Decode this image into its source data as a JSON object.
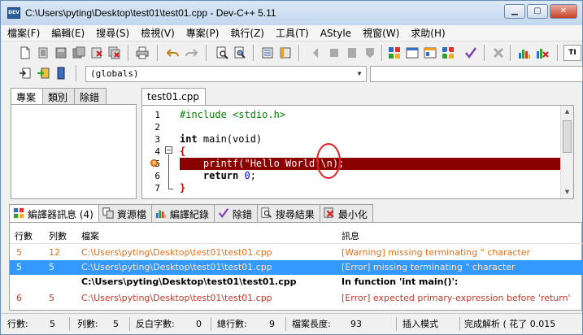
{
  "window": {
    "title": "C:\\Users\\pyting\\Desktop\\test01\\test01.cpp - Dev-C++ 5.11",
    "minimize": "▁",
    "maximize": "▢",
    "close": "✕"
  },
  "menu": [
    "檔案(F)",
    "編輯(E)",
    "搜尋(S)",
    "檢視(V)",
    "專案(P)",
    "執行(Z)",
    "工具(T)",
    "AStyle",
    "視窗(W)",
    "求助(H)"
  ],
  "toolbar": {
    "overflow_label": "TI",
    "scope_combo": "(globals)",
    "function_combo": ""
  },
  "left_panel": {
    "tabs": [
      "專案",
      "類別",
      "除錯"
    ]
  },
  "editor": {
    "tab": "test01.cpp",
    "line_numbers": [
      "1",
      "2",
      "3",
      "4",
      "5",
      "6",
      "7"
    ],
    "lines": [
      {
        "type": "pp",
        "text": "#include <stdio.h>"
      },
      {
        "type": "blank",
        "text": ""
      },
      {
        "type": "code",
        "kw": "int",
        "rest": " main(void)"
      },
      {
        "type": "brace",
        "text": "{"
      },
      {
        "type": "err",
        "text": "    printf(\"Hello World!\\n);"
      },
      {
        "type": "return",
        "kw": "return",
        "num": "0",
        "text": "    return 0;"
      },
      {
        "type": "brace",
        "text": "}"
      }
    ]
  },
  "bottom_tabs": [
    {
      "label": "編譯器訊息 (4)",
      "icon": "grid-icon"
    },
    {
      "label": "資源檔",
      "icon": "resource-icon"
    },
    {
      "label": "編譯紀錄",
      "icon": "chart-icon"
    },
    {
      "label": "除錯",
      "icon": "check-icon"
    },
    {
      "label": "搜尋結果",
      "icon": "search-icon"
    },
    {
      "label": "最小化",
      "icon": "close-icon"
    }
  ],
  "messages": {
    "headers": {
      "line": "行數",
      "col": "列數",
      "file": "檔案",
      "msg": "訊息"
    },
    "rows": [
      {
        "line": "5",
        "col": "12",
        "file": "C:\\Users\\pyting\\Desktop\\test01\\test01.cpp",
        "msg": "[Warning] missing terminating \" character",
        "style": "warn"
      },
      {
        "line": "5",
        "col": "5",
        "file": "C:\\Users\\pyting\\Desktop\\test01\\test01.cpp",
        "msg": "[Error] missing terminating \" character",
        "style": "sel"
      },
      {
        "line": "",
        "col": "",
        "file": "C:\\Users\\pyting\\Desktop\\test01\\test01.cpp",
        "msg": "In function 'int main()':",
        "style": "bold"
      },
      {
        "line": "6",
        "col": "5",
        "file": "C:\\Users\\pyting\\Desktop\\test01\\test01.cpp",
        "msg": "[Error] expected primary-expression before 'return'",
        "style": "error"
      }
    ]
  },
  "status": {
    "line_label": "行數:",
    "line_value": "5",
    "col_label": "列數:",
    "col_value": "5",
    "sel_label": "反白字數:",
    "sel_value": "0",
    "total_label": "總行數:",
    "total_value": "9",
    "len_label": "檔案長度:",
    "len_value": "93",
    "mode": "插入模式",
    "parse": "完成解析 ( 花了 0.015"
  },
  "colors": {
    "error_line_bg": "#8b0000",
    "warning_text": "#e0701a",
    "error_text": "#c0392b",
    "selected_row": "#3399ff",
    "circle": "#e02020"
  }
}
